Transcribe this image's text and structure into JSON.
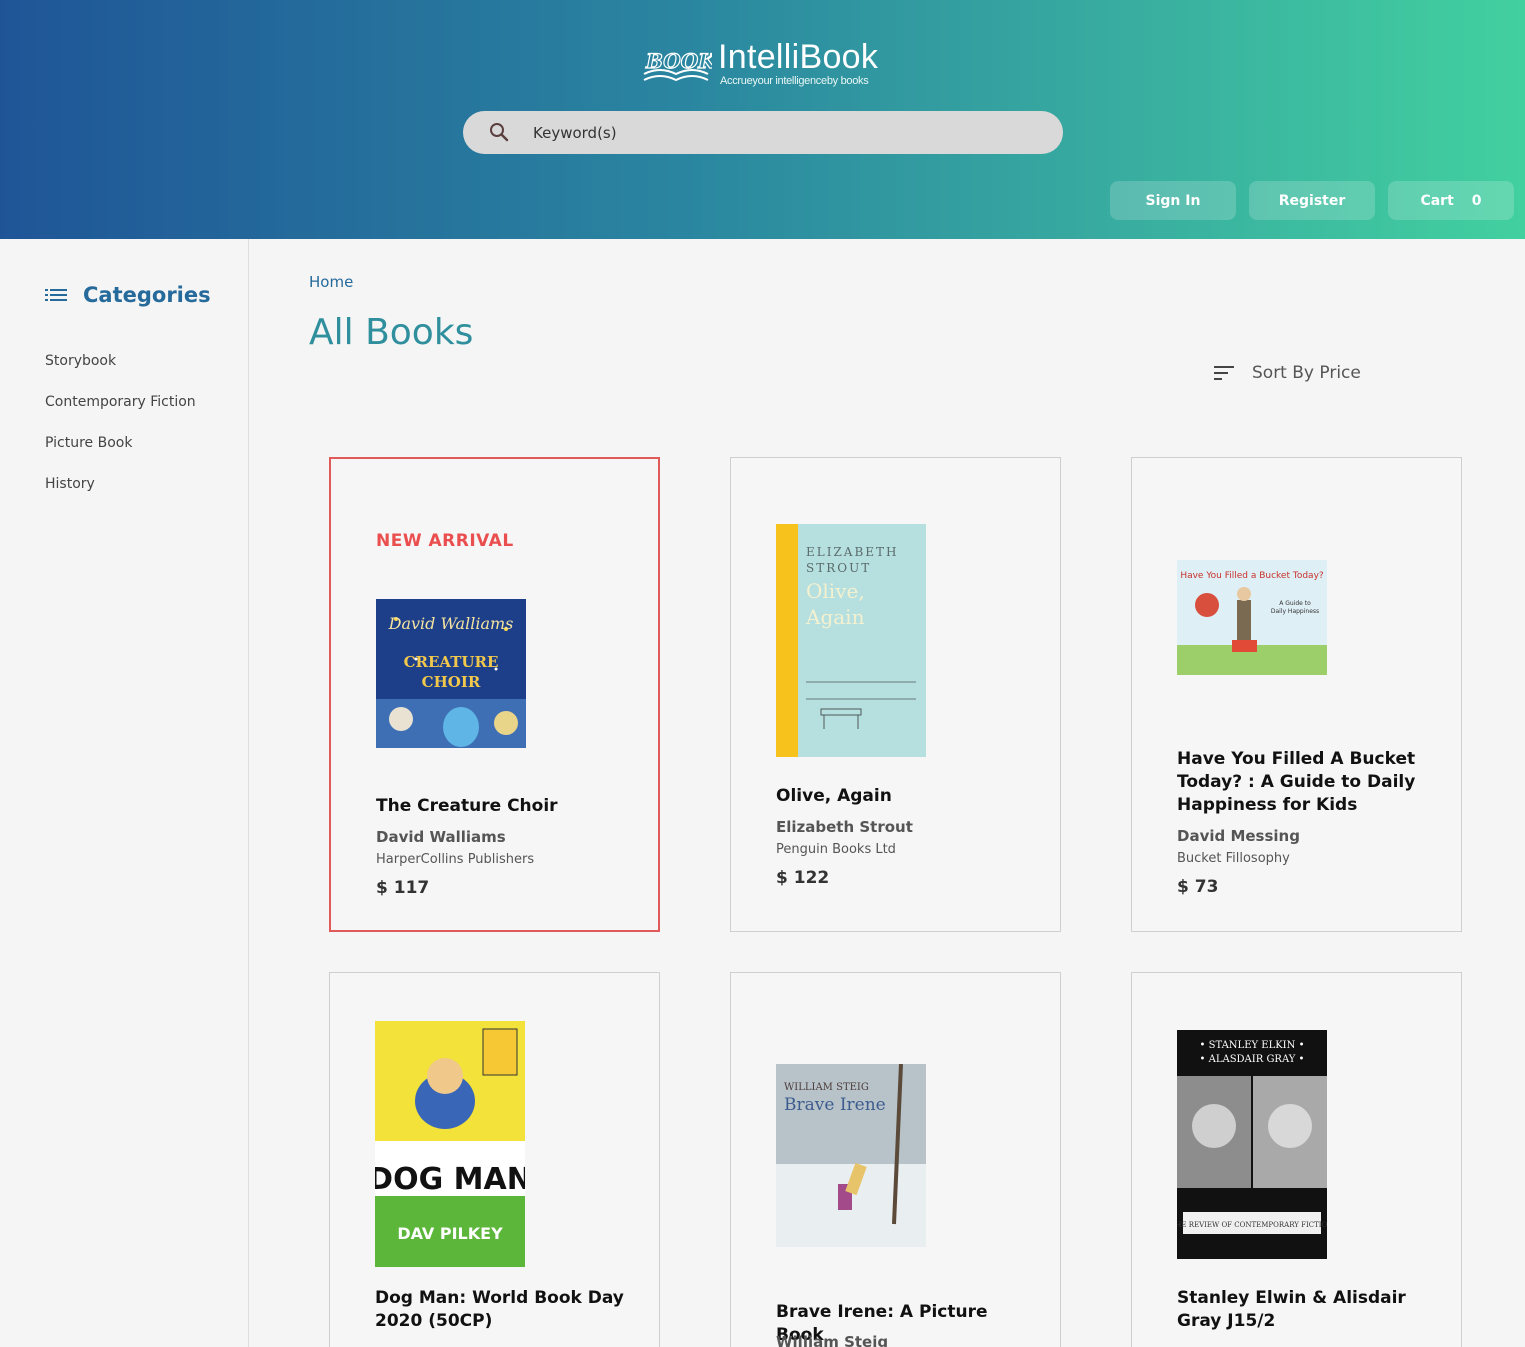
{
  "header": {
    "logo_title": "IntelliBook",
    "logo_tagline": "Accrueyour intelligenceby books",
    "search_placeholder": "Keyword(s)",
    "sign_in": "Sign In",
    "register": "Register",
    "cart_label": "Cart",
    "cart_count": "0"
  },
  "sidebar": {
    "title": "Categories",
    "items": [
      "Storybook",
      "Contemporary Fiction",
      "Picture Book",
      "History"
    ]
  },
  "main": {
    "breadcrumb": "Home",
    "title": "All Books",
    "sort_label": "Sort By Price"
  },
  "books": [
    {
      "badge": "NEW ARRIVAL",
      "title": "The Creature Choir",
      "author": "David Walliams",
      "publisher": "HarperCollins Publishers",
      "price": "$ 117",
      "cover_text": "David Walliams THE CREATURE CHOIR"
    },
    {
      "title": "Olive, Again",
      "author": "Elizabeth Strout",
      "publisher": "Penguin Books Ltd",
      "price": "$ 122",
      "cover_text": "ELIZABETH STROUT Olive, Again"
    },
    {
      "title": "Have You Filled A Bucket Today? : A Guide to Daily Happiness for Kids",
      "author": "David Messing",
      "publisher": "Bucket Fillosophy",
      "price": "$ 73",
      "cover_text": "Have You Filled a Bucket Today?"
    },
    {
      "title": "Dog Man: World Book Day 2020 (50CP)",
      "author": "Dav Pilkey",
      "cover_text": "DOG MAN DAV PILKEY"
    },
    {
      "title": "Brave Irene: A Picture Book",
      "author": "William Steig",
      "cover_text": "WILLIAM STEIG Brave Irene"
    },
    {
      "title": "Stanley Elwin & Alisdair Gray J15/2",
      "author": "Review of Contemporary Fiction",
      "cover_text": "STANLEY ELKIN ALASDAIR GRAY"
    }
  ],
  "colors": {
    "header_start": "#1f5597",
    "header_end": "#42d09f",
    "accent_blue": "#256a9b",
    "title_teal": "#2f8f9d",
    "badge_red": "#ea4e4e"
  }
}
